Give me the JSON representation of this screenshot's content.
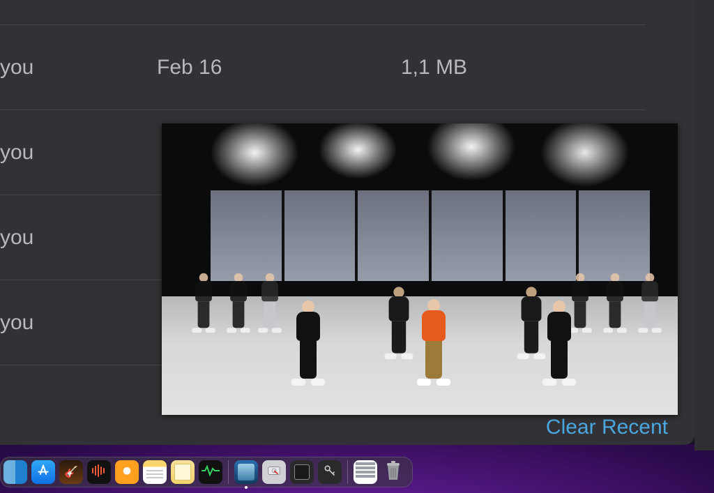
{
  "list": {
    "rows": [
      {
        "owner": "you",
        "date": "Feb 16",
        "size": "1,1 MB"
      },
      {
        "owner": "you",
        "date": "",
        "size": ""
      },
      {
        "owner": "you",
        "date": "",
        "size": ""
      },
      {
        "owner": "you",
        "date": "",
        "size": ""
      }
    ]
  },
  "actions": {
    "clear_recent": "Clear Recent"
  },
  "dock": {
    "apps": [
      {
        "name": "partial-app"
      },
      {
        "name": "app-store"
      },
      {
        "name": "garageband"
      },
      {
        "name": "voice-memos"
      },
      {
        "name": "orange-circle-app"
      },
      {
        "name": "notes"
      },
      {
        "name": "stickies"
      },
      {
        "name": "activity-monitor"
      },
      {
        "name": "preview",
        "running": true
      },
      {
        "name": "disk-utility"
      },
      {
        "name": "system-information"
      },
      {
        "name": "keychain-access"
      },
      {
        "name": "textedit"
      },
      {
        "name": "trash"
      }
    ]
  }
}
